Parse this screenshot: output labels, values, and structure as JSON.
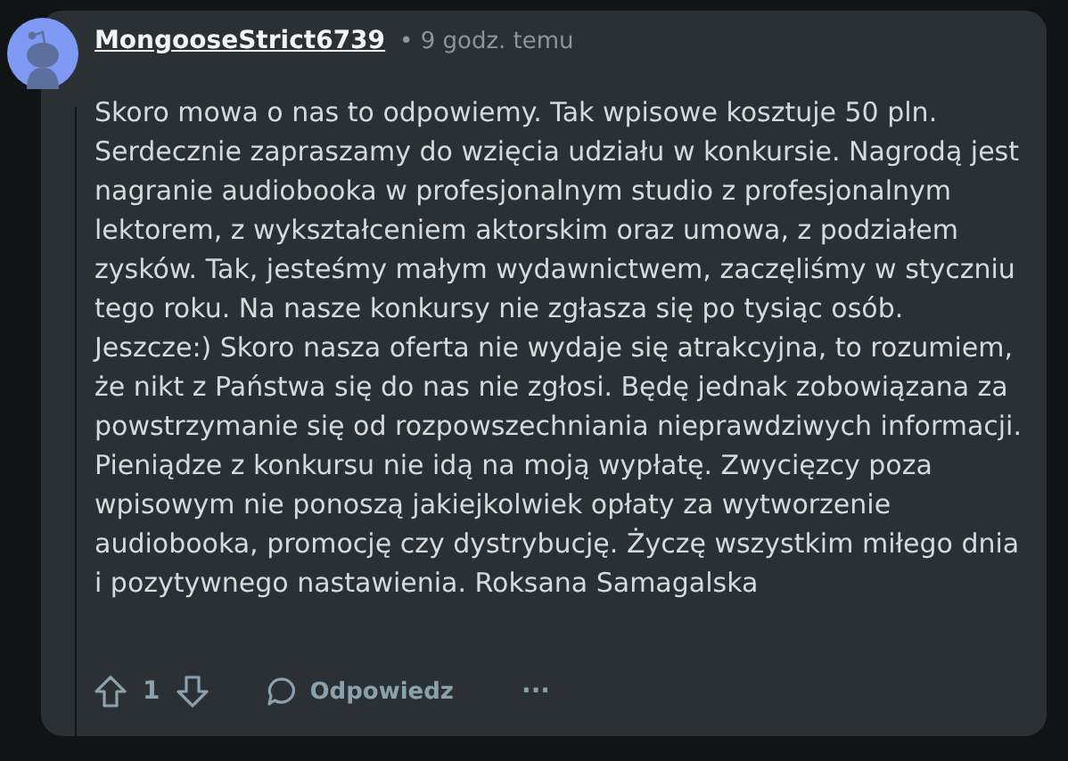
{
  "comment": {
    "author": "MongooseStrict6739",
    "time": "• 9 godz. temu",
    "body": "Skoro mowa o nas to odpowiemy. Tak wpisowe kosztuje 50 pln. Serdecznie zapraszamy do wzięcia udziału w konkursie. Nagrodą jest nagranie audiobooka w profesjonalnym studio z profesjonalnym lektorem, z wykształceniem aktorskim oraz umowa, z podziałem zysków. Tak, jesteśmy małym wydawnictwem, zaczęliśmy w styczniu tego roku. Na nasze konkursy nie zgłasza się po tysiąc osób. Jeszcze:) Skoro nasza oferta nie wydaje się atrakcyjna, to rozumiem, że nikt z Państwa się do nas nie zgłosi. Będę jednak zobowiązana za powstrzymanie się od rozpowszechniania nieprawdziwych informacji. Pieniądze z konkursu nie idą na moją wypłatę. Zwycięzcy poza wpisowym nie ponoszą jakiejkolwiek opłaty za wytworzenie audiobooka, promocję czy dystrybucję. Życzę wszystkim miłego dnia i pozytywnego nastawienia. Roksana Samagalska",
    "score": "1",
    "reply": "Odpowiedz",
    "more": "···"
  }
}
